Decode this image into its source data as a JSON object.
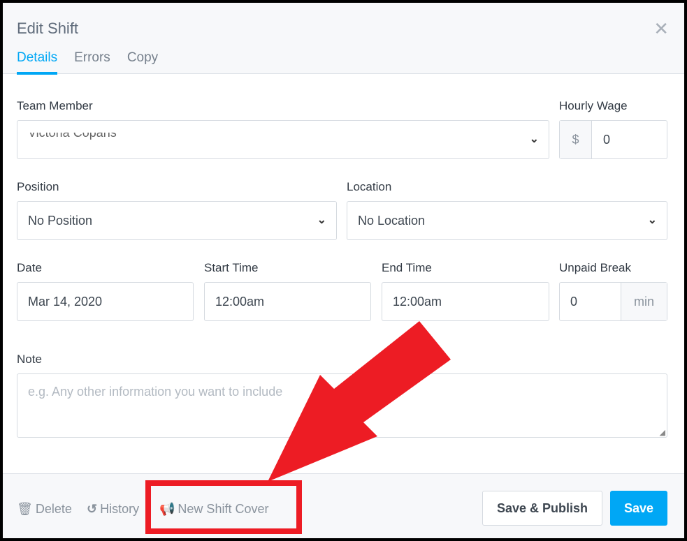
{
  "header": {
    "title": "Edit Shift",
    "tabs": [
      {
        "label": "Details",
        "active": true
      },
      {
        "label": "Errors"
      },
      {
        "label": "Copy"
      }
    ]
  },
  "form": {
    "team_member": {
      "label": "Team Member",
      "value": "Victoria Copans"
    },
    "hourly_wage": {
      "label": "Hourly Wage",
      "prefix": "$",
      "value": "0"
    },
    "position": {
      "label": "Position",
      "value": "No Position"
    },
    "location": {
      "label": "Location",
      "value": "No Location"
    },
    "date": {
      "label": "Date",
      "value": "Mar 14, 2020"
    },
    "start_time": {
      "label": "Start Time",
      "value": "12:00am"
    },
    "end_time": {
      "label": "End Time",
      "value": "12:00am"
    },
    "unpaid_break": {
      "label": "Unpaid Break",
      "value": "0",
      "suffix": "min"
    },
    "note": {
      "label": "Note",
      "placeholder": "e.g. Any other information you want to include"
    }
  },
  "footer": {
    "delete": "Delete",
    "history": "History",
    "new_shift_cover": "New Shift Cover",
    "save_publish": "Save & Publish",
    "save": "Save"
  },
  "annotation": {
    "color": "#ed1c24"
  },
  "colors": {
    "accent": "#00a7f5"
  }
}
